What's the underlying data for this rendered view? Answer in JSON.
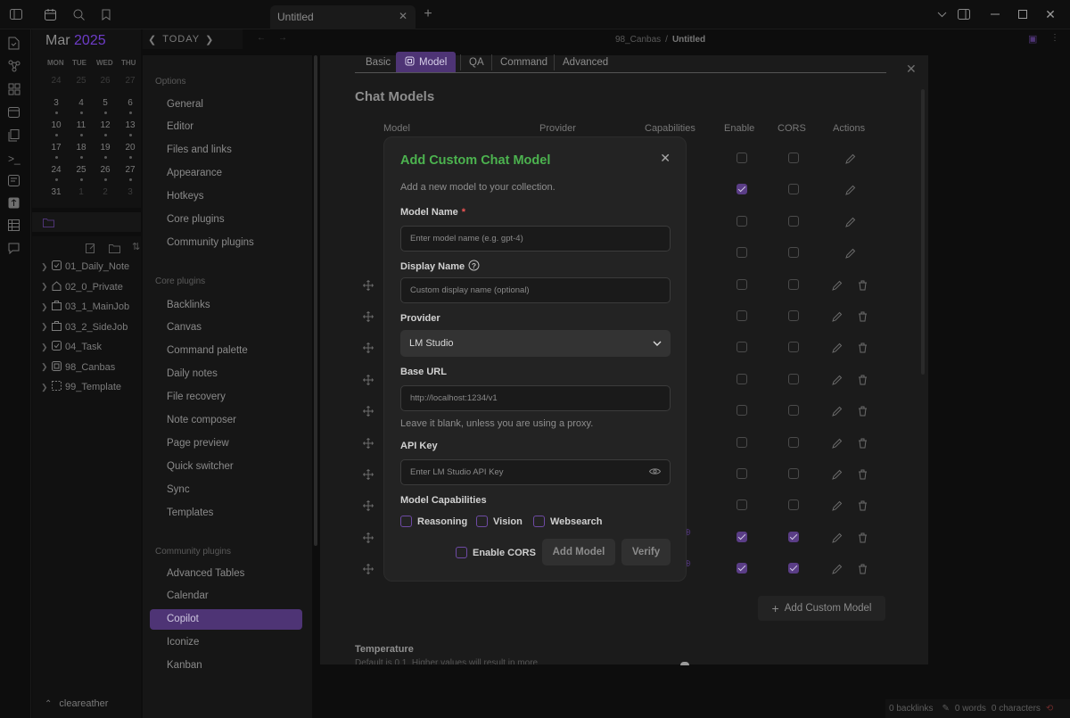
{
  "titlebar": {
    "tab_title": "Untitled",
    "breadcrumb_folder": "98_Canbas",
    "breadcrumb_sep": "/",
    "breadcrumb_file": "Untitled"
  },
  "calendar": {
    "month": "Mar",
    "year": "2025",
    "today_label": "TODAY",
    "weekdays": [
      "MON",
      "TUE",
      "WED",
      "THU"
    ],
    "weeks": [
      [
        "24",
        "25",
        "26",
        "27"
      ],
      [
        "3",
        "4",
        "5",
        "6"
      ],
      [
        "10",
        "11",
        "12",
        "13"
      ],
      [
        "17",
        "18",
        "19",
        "20"
      ],
      [
        "24",
        "25",
        "26",
        "27"
      ],
      [
        "31",
        "1",
        "2",
        "3"
      ]
    ]
  },
  "explorer": {
    "items": [
      "01_Daily_Note",
      "02_0_Private",
      "03_1_MainJob",
      "03_2_SideJob",
      "04_Task",
      "98_Canbas",
      "99_Template"
    ],
    "vault_name": "cleareather"
  },
  "settings_nav": {
    "options_title": "Options",
    "options": [
      "General",
      "Editor",
      "Files and links",
      "Appearance",
      "Hotkeys",
      "Core plugins",
      "Community plugins"
    ],
    "core_title": "Core plugins",
    "core": [
      "Backlinks",
      "Canvas",
      "Command palette",
      "Daily notes",
      "File recovery",
      "Note composer",
      "Page preview",
      "Quick switcher",
      "Sync",
      "Templates"
    ],
    "community_title": "Community plugins",
    "community": [
      "Advanced Tables",
      "Calendar",
      "Copilot",
      "Iconize",
      "Kanban"
    ]
  },
  "settings_tabs": [
    "Basic",
    "Model",
    "QA",
    "Command",
    "Advanced"
  ],
  "chat_models": {
    "title": "Chat Models",
    "columns": [
      "Model",
      "Provider",
      "Capabilities",
      "Enable",
      "CORS",
      "Actions"
    ],
    "rows": [
      {
        "enable": false,
        "cors": false,
        "draggable": false,
        "deletable": false
      },
      {
        "enable": true,
        "cors": false,
        "draggable": false,
        "deletable": false
      },
      {
        "enable": false,
        "cors": false,
        "draggable": false,
        "deletable": false
      },
      {
        "enable": false,
        "cors": false,
        "draggable": false,
        "deletable": false
      },
      {
        "enable": false,
        "cors": false,
        "draggable": true,
        "deletable": true
      },
      {
        "enable": false,
        "cors": false,
        "draggable": true,
        "deletable": true
      },
      {
        "enable": false,
        "cors": false,
        "draggable": true,
        "deletable": true
      },
      {
        "enable": false,
        "cors": false,
        "draggable": true,
        "deletable": true
      },
      {
        "enable": false,
        "cors": false,
        "draggable": true,
        "deletable": true
      },
      {
        "enable": false,
        "cors": false,
        "draggable": true,
        "deletable": true
      },
      {
        "enable": false,
        "cors": false,
        "draggable": true,
        "deletable": true
      },
      {
        "enable": false,
        "cors": false,
        "draggable": true,
        "deletable": true
      },
      {
        "enable": true,
        "cors": true,
        "draggable": true,
        "deletable": true
      },
      {
        "enable": true,
        "cors": true,
        "draggable": true,
        "deletable": true
      }
    ],
    "add_custom_label": "Add Custom Model",
    "temperature_label": "Temperature",
    "temperature_desc": "Default is 0.1. Higher values will result in more"
  },
  "modal": {
    "title": "Add Custom Chat Model",
    "description": "Add a new model to your collection.",
    "model_name_label": "Model Name",
    "required_mark": "*",
    "model_name_placeholder": "Enter model name (e.g. gpt-4)",
    "display_name_label": "Display Name",
    "display_name_placeholder": "Custom display name (optional)",
    "provider_label": "Provider",
    "provider_value": "LM Studio",
    "base_url_label": "Base URL",
    "base_url_placeholder": "http://localhost:1234/v1",
    "base_url_hint": "Leave it blank, unless you are using a proxy.",
    "api_key_label": "API Key",
    "api_key_placeholder": "Enter LM Studio API Key",
    "capabilities_label": "Model Capabilities",
    "capabilities": [
      "Reasoning",
      "Vision",
      "Websearch"
    ],
    "enable_cors_label": "Enable CORS",
    "add_button": "Add Model",
    "verify_button": "Verify",
    "title_color": "#4cb34f",
    "accent_color": "#6e4aa4"
  },
  "statusbar": {
    "backlinks": "0 backlinks",
    "words": "0 words",
    "characters": "0 characters"
  }
}
